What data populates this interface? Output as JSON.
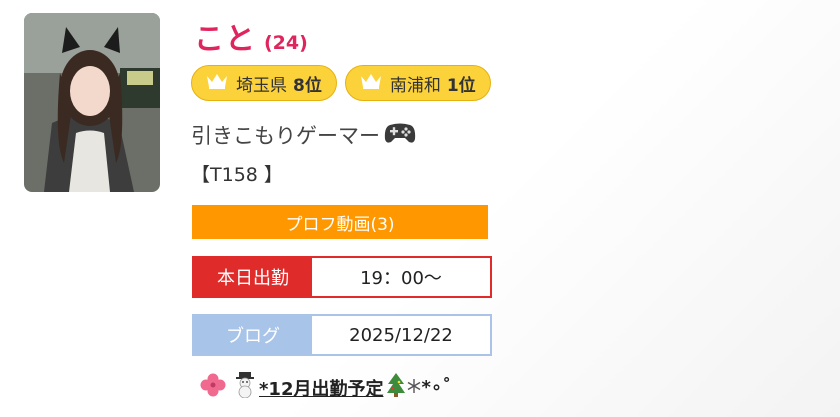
{
  "profile": {
    "name": "こと",
    "age": "(24)",
    "ranks": [
      {
        "area": "埼玉県",
        "rank": "8位"
      },
      {
        "area": "南浦和",
        "rank": "1位"
      }
    ],
    "catchphrase": "引きこもりゲーマー",
    "spec": "【T158 】"
  },
  "video_button": {
    "label": "プロフ動画(3)"
  },
  "work": {
    "label": "本日出勤",
    "value": "19：00〜"
  },
  "blog": {
    "label": "ブログ",
    "value": "2025/12/22"
  },
  "news": {
    "text": "*12月出勤予定",
    "suffix": "*∘˚"
  },
  "colors": {
    "name": "#e0245e",
    "rank_badge": "#fcd23b",
    "video_button": "#ff9800",
    "work_accent": "#e02b2b",
    "blog_accent": "#a9c4e9"
  },
  "icons": [
    "crown-icon",
    "gamepad-icon",
    "clover-icon",
    "snowman-icon",
    "christmas-tree-icon",
    "snowflake-icon"
  ]
}
